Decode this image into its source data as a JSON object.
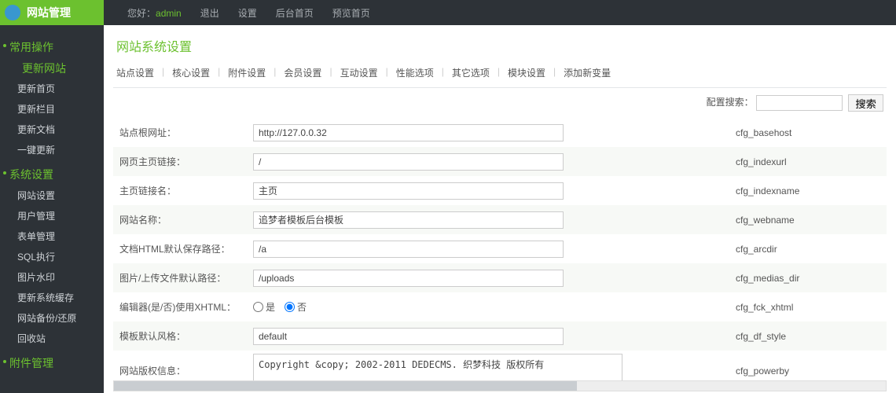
{
  "header": {
    "logo": "网站管理",
    "greet_prefix": "您好：",
    "user": "admin",
    "menu": [
      "退出",
      "设置",
      "后台首页",
      "预览首页"
    ]
  },
  "sidebar": {
    "groups": [
      {
        "title": "常用操作",
        "items": [
          {
            "label": "更新网站",
            "highlight": true
          },
          {
            "label": "更新首页"
          },
          {
            "label": "更新栏目"
          },
          {
            "label": "更新文档"
          },
          {
            "label": "一键更新"
          }
        ]
      },
      {
        "title": "系统设置",
        "items": [
          {
            "label": "网站设置"
          },
          {
            "label": "用户管理"
          },
          {
            "label": "表单管理"
          },
          {
            "label": "SQL执行"
          },
          {
            "label": "图片水印"
          },
          {
            "label": "更新系统缓存"
          },
          {
            "label": "网站备份/还原"
          },
          {
            "label": "回收站"
          }
        ]
      },
      {
        "title": "附件管理",
        "items": []
      }
    ]
  },
  "page": {
    "title": "网站系统设置",
    "tabs": [
      "站点设置",
      "核心设置",
      "附件设置",
      "会员设置",
      "互动设置",
      "性能选项",
      "其它选项",
      "模块设置",
      "添加新变量"
    ],
    "search_label": "配置搜索：",
    "search_btn": "搜索"
  },
  "rows": [
    {
      "label": "站点根网址：",
      "type": "text",
      "value": "http://127.0.0.32",
      "key": "cfg_basehost"
    },
    {
      "label": "网页主页链接：",
      "type": "text",
      "value": "/",
      "key": "cfg_indexurl"
    },
    {
      "label": "主页链接名：",
      "type": "text",
      "value": "主页",
      "key": "cfg_indexname"
    },
    {
      "label": "网站名称：",
      "type": "text",
      "value": "追梦者模板后台模板",
      "key": "cfg_webname"
    },
    {
      "label": "文档HTML默认保存路径：",
      "type": "text",
      "value": "/a",
      "key": "cfg_arcdir"
    },
    {
      "label": "图片/上传文件默认路径：",
      "type": "text",
      "value": "/uploads",
      "key": "cfg_medias_dir"
    },
    {
      "label": "编辑器(是/否)使用XHTML：",
      "type": "radio",
      "opts": [
        {
          "l": "是",
          "c": false
        },
        {
          "l": "否",
          "c": true
        }
      ],
      "key": "cfg_fck_xhtml"
    },
    {
      "label": "模板默认风格：",
      "type": "text",
      "value": "default",
      "key": "cfg_df_style"
    },
    {
      "label": "网站版权信息：",
      "type": "textarea",
      "value": "Copyright &copy; 2002-2011 DEDECMS. 织梦科技 版权所有",
      "key": "cfg_powerby"
    }
  ]
}
